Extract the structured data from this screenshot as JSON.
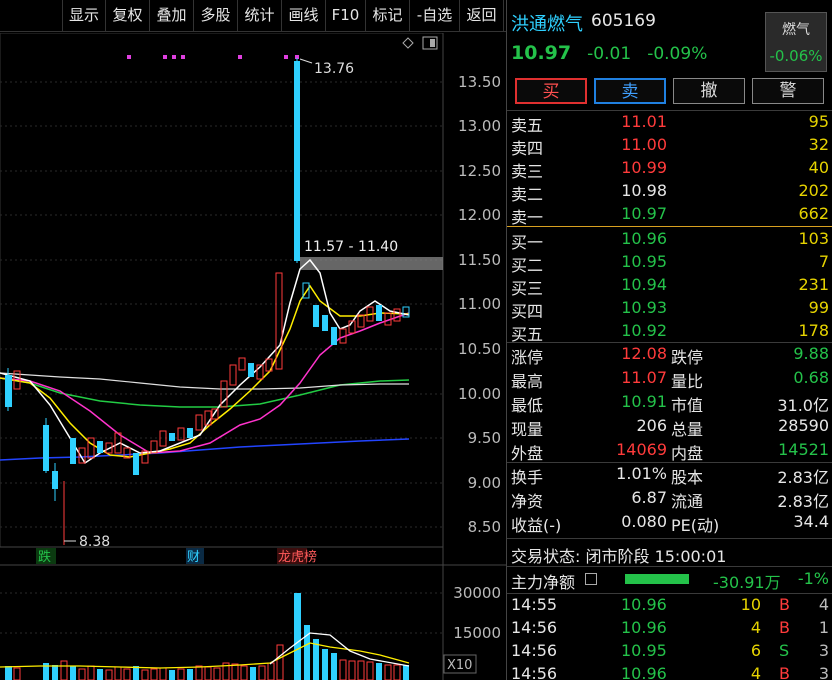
{
  "toolbar": [
    "显示",
    "复权",
    "叠加",
    "多股",
    "统计",
    "画线",
    "F10",
    "标记",
    "-自选",
    "返回"
  ],
  "chart": {
    "price_labels": [
      "13.50",
      "13.00",
      "12.50",
      "12.00",
      "11.50",
      "11.00",
      "10.50",
      "10.00",
      "9.50",
      "9.00",
      "8.50"
    ],
    "high_label": "13.76",
    "low_label": "8.38",
    "range_label": "11.57 - 11.40",
    "event_tags": [
      "跌",
      "财",
      "龙虎榜"
    ],
    "vol_labels": [
      "30000",
      "15000"
    ],
    "vol_unit": "X10"
  },
  "stock": {
    "name": "洪通燃气",
    "code": "605169",
    "price": "10.97",
    "change": "-0.01",
    "pct": "-0.09%"
  },
  "sector": {
    "name": "燃气",
    "change": "-0.06%"
  },
  "actions": [
    "买",
    "卖",
    "撤",
    "警"
  ],
  "asks": [
    {
      "label": "卖五",
      "price": "11.01",
      "vol": "95",
      "color": "red"
    },
    {
      "label": "卖四",
      "price": "11.00",
      "vol": "32",
      "color": "red"
    },
    {
      "label": "卖三",
      "price": "10.99",
      "vol": "40",
      "color": "red"
    },
    {
      "label": "卖二",
      "price": "10.98",
      "vol": "202",
      "color": "white"
    },
    {
      "label": "卖一",
      "price": "10.97",
      "vol": "662",
      "color": "green"
    }
  ],
  "bids": [
    {
      "label": "买一",
      "price": "10.96",
      "vol": "103",
      "color": "green"
    },
    {
      "label": "买二",
      "price": "10.95",
      "vol": "7",
      "color": "green"
    },
    {
      "label": "买三",
      "price": "10.94",
      "vol": "231",
      "color": "green"
    },
    {
      "label": "买四",
      "price": "10.93",
      "vol": "99",
      "color": "green"
    },
    {
      "label": "买五",
      "price": "10.92",
      "vol": "178",
      "color": "green"
    }
  ],
  "stats1": [
    {
      "l1": "涨停",
      "v1": "12.08",
      "c1": "red",
      "l2": "跌停",
      "v2": "9.88",
      "c2": "green"
    },
    {
      "l1": "最高",
      "v1": "11.07",
      "c1": "red",
      "l2": "量比",
      "v2": "0.68",
      "c2": "green"
    },
    {
      "l1": "最低",
      "v1": "10.91",
      "c1": "green",
      "l2": "市值",
      "v2": "31.0亿",
      "c2": "white"
    },
    {
      "l1": "现量",
      "v1": "206",
      "c1": "white",
      "l2": "总量",
      "v2": "28590",
      "c2": "white"
    },
    {
      "l1": "外盘",
      "v1": "14069",
      "c1": "red",
      "l2": "内盘",
      "v2": "14521",
      "c2": "green"
    }
  ],
  "stats2": [
    {
      "l1": "换手",
      "v1": "1.01%",
      "l2": "股本",
      "v2": "2.83亿"
    },
    {
      "l1": "净资",
      "v1": "6.87",
      "l2": "流通",
      "v2": "2.83亿"
    },
    {
      "l1": "收益(-)",
      "v1": "0.080",
      "l2": "PE(动)",
      "v2": "34.4"
    }
  ],
  "trade_status": "交易状态: 闭市阶段 15:00:01",
  "main_flow": {
    "label": "主力净额",
    "value": "-30.91万",
    "pct": "-1%"
  },
  "ticks": [
    {
      "time": "14:55",
      "price": "10.96",
      "vol": "10",
      "side": "B",
      "side_color": "red",
      "n": "4"
    },
    {
      "time": "14:56",
      "price": "10.96",
      "vol": "4",
      "side": "B",
      "side_color": "red",
      "n": "1"
    },
    {
      "time": "14:56",
      "price": "10.95",
      "vol": "6",
      "side": "S",
      "side_color": "green",
      "n": "3"
    },
    {
      "time": "14:56",
      "price": "10.96",
      "vol": "4",
      "side": "B",
      "side_color": "red",
      "n": "3"
    }
  ]
}
